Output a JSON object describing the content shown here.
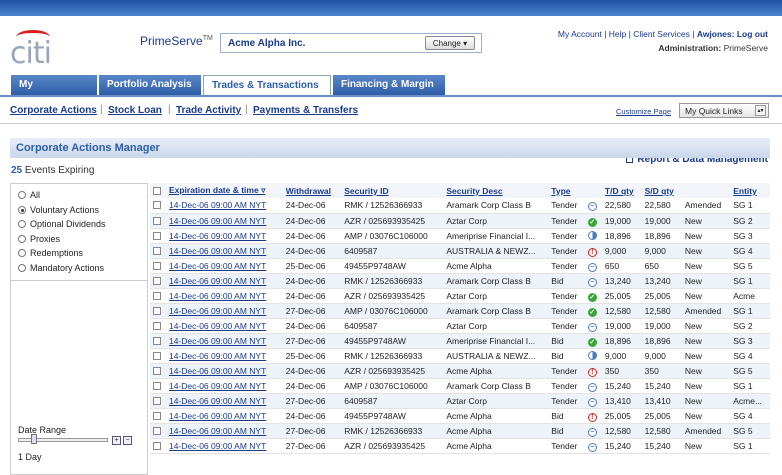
{
  "brand": {
    "logo": "citi",
    "product": "PrimeServe",
    "tm": "TM"
  },
  "account": {
    "name": "Acme Alpha Inc.",
    "change_label": "Change ▾"
  },
  "header_links": {
    "my_account": "My Account",
    "help": "Help",
    "client_services": "Client Services",
    "user": "Awjones:",
    "logout": "Log out",
    "admin_label": "Administration:",
    "admin_value": "PrimeServe"
  },
  "tabs": [
    {
      "label": "My PrimeServe"
    },
    {
      "label": "Portfolio Analysis ▾"
    },
    {
      "label": "Trades & Transactions ▾"
    },
    {
      "label": "Financing & Margin ▾"
    }
  ],
  "report_link": "Report & Data Management",
  "subnav": [
    "Corporate Actions",
    "Stock Loan",
    "Trade Activity",
    "Payments & Transfers"
  ],
  "customize": "Customize Page",
  "quick_links": "My Quick Links",
  "panel_title": "Corporate Actions Manager",
  "expiring": {
    "count": "25",
    "label": "Events Expiring"
  },
  "filters": [
    {
      "label": "All",
      "selected": false
    },
    {
      "label": "Voluntary Actions",
      "selected": true
    },
    {
      "label": "Optional Dividends",
      "selected": false
    },
    {
      "label": "Proxies",
      "selected": false
    },
    {
      "label": "Redemptions",
      "selected": false
    },
    {
      "label": "Mandatory Actions",
      "selected": false
    }
  ],
  "date_range": {
    "label": "Date Range",
    "value": "1 Day"
  },
  "columns": [
    "Expiration date & time ▿",
    "Withdrawal",
    "Security ID",
    "Security Desc",
    "Type",
    "T/D qty",
    "S/D qty",
    "",
    "Entity"
  ],
  "rows": [
    {
      "exp": "14-Dec-06 09:00 AM NYT",
      "wd": "24-Dec-06",
      "sec": "RMK / 12526366933",
      "desc": "Aramark Corp Class B",
      "type": "Tender",
      "status": "dash",
      "td": "22,580",
      "sd": "22,580",
      "st": "Amended",
      "ent": "SG 1"
    },
    {
      "exp": "14-Dec-06 09:00 AM NYT",
      "wd": "24-Dec-06",
      "sec": "AZR / 025693935425",
      "desc": "Aztar Corp",
      "type": "Tender",
      "status": "check",
      "td": "19,000",
      "sd": "19,000",
      "st": "New",
      "ent": "SG 2"
    },
    {
      "exp": "14-Dec-06 09:00 AM NYT",
      "wd": "24-Dec-06",
      "sec": "AMP / 03076C106000",
      "desc": "Ameriprise Financial I...",
      "type": "Tender",
      "status": "half",
      "td": "18,896",
      "sd": "18,896",
      "st": "New",
      "ent": "SG 3"
    },
    {
      "exp": "14-Dec-06 09:00 AM NYT",
      "wd": "24-Dec-06",
      "sec": "6409587",
      "desc": "AUSTRALIA & NEWZ...",
      "type": "Tender",
      "status": "bang",
      "td": "9,000",
      "sd": "9,000",
      "st": "New",
      "ent": "SG 4"
    },
    {
      "exp": "14-Dec-06 09:00 AM NYT",
      "wd": "25-Dec-06",
      "sec": "49455P9748AW",
      "desc": "Acme Alpha",
      "type": "Tender",
      "status": "dash",
      "td": "650",
      "sd": "650",
      "st": "New",
      "ent": "SG 5"
    },
    {
      "exp": "14-Dec-06 09:00 AM NYT",
      "wd": "24-Dec-06",
      "sec": "RMK / 12526366933",
      "desc": "Aramark Corp Class B",
      "type": "Bid",
      "status": "dash",
      "td": "13,240",
      "sd": "13,240",
      "st": "New",
      "ent": "SG 1"
    },
    {
      "exp": "14-Dec-06 09:00 AM NYT",
      "wd": "24-Dec-06",
      "sec": "AZR / 025693935425",
      "desc": "Aztar Corp",
      "type": "Tender",
      "status": "check",
      "td": "25,005",
      "sd": "25,005",
      "st": "New",
      "ent": "Acme"
    },
    {
      "exp": "14-Dec-06 09:00 AM NYT",
      "wd": "27-Dec-06",
      "sec": "AMP / 03076C106000",
      "desc": "Aramark Corp Class B",
      "type": "Tender",
      "status": "check",
      "td": "12,580",
      "sd": "12,580",
      "st": "Amended",
      "ent": "SG 1"
    },
    {
      "exp": "14-Dec-06 09:00 AM NYT",
      "wd": "24-Dec-06",
      "sec": "6409587",
      "desc": "Aztar Corp",
      "type": "Tender",
      "status": "dash",
      "td": "19,000",
      "sd": "19,000",
      "st": "New",
      "ent": "SG 2"
    },
    {
      "exp": "14-Dec-06 09:00 AM NYT",
      "wd": "27-Dec-06",
      "sec": "49455P9748AW",
      "desc": "Ameriprise Financial I...",
      "type": "Bid",
      "status": "check",
      "td": "18,896",
      "sd": "18,896",
      "st": "New",
      "ent": "SG 3"
    },
    {
      "exp": "14-Dec-06 09:00 AM NYT",
      "wd": "25-Dec-06",
      "sec": "RMK / 12526366933",
      "desc": "AUSTRALIA & NEWZ...",
      "type": "Bid",
      "status": "half",
      "td": "9,000",
      "sd": "9,000",
      "st": "New",
      "ent": "SG 4"
    },
    {
      "exp": "14-Dec-06 09:00 AM NYT",
      "wd": "24-Dec-06",
      "sec": "AZR / 025693935425",
      "desc": "Acme Alpha",
      "type": "Tender",
      "status": "bang",
      "td": "350",
      "sd": "350",
      "st": "New",
      "ent": "SG 5"
    },
    {
      "exp": "14-Dec-06 09:00 AM NYT",
      "wd": "24-Dec-06",
      "sec": "AMP / 03076C106000",
      "desc": "Aramark Corp Class B",
      "type": "Tender",
      "status": "dash",
      "td": "15,240",
      "sd": "15,240",
      "st": "New",
      "ent": "SG 1"
    },
    {
      "exp": "14-Dec-06 09:00 AM NYT",
      "wd": "27-Dec-06",
      "sec": "6409587",
      "desc": "Aztar Corp",
      "type": "Tender",
      "status": "dash",
      "td": "13,410",
      "sd": "13,410",
      "st": "New",
      "ent": "Acme..."
    },
    {
      "exp": "14-Dec-06 09:00 AM NYT",
      "wd": "24-Dec-06",
      "sec": "49455P9748AW",
      "desc": "Acme Alpha",
      "type": "Bid",
      "status": "bang",
      "td": "25,005",
      "sd": "25,005",
      "st": "New",
      "ent": "SG 4"
    },
    {
      "exp": "14-Dec-06 09:00 AM NYT",
      "wd": "27-Dec-06",
      "sec": "RMK / 12526366933",
      "desc": "Acme Alpha",
      "type": "Bid",
      "status": "dash",
      "td": "12,580",
      "sd": "12,580",
      "st": "Amended",
      "ent": "SG 5"
    },
    {
      "exp": "14-Dec-06 09:00 AM NYT",
      "wd": "27-Dec-06",
      "sec": "AZR / 025693935425",
      "desc": "Acme Alpha",
      "type": "Tender",
      "status": "dash",
      "td": "15,240",
      "sd": "15,240",
      "st": "New",
      "ent": "SG 1"
    }
  ]
}
